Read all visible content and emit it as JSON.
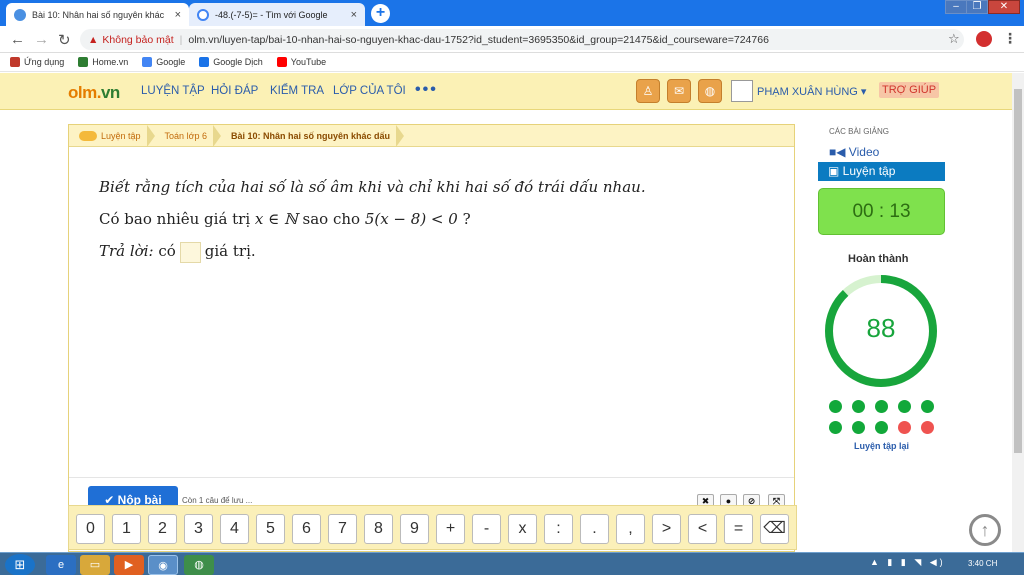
{
  "browser": {
    "tabs": [
      {
        "title": "Bài 10: Nhân hai số nguyên khác",
        "close": "×",
        "active": true
      },
      {
        "title": "-48.(-7-5)= - Tìm với Google",
        "close": "×",
        "active": false
      }
    ],
    "new_tab": "+",
    "window_buttons": {
      "minimize": "–",
      "maximize": "❐",
      "close": "✕"
    },
    "nav": {
      "back": "←",
      "forward": "→",
      "reload": "↻"
    },
    "address": {
      "warning_icon": "▲",
      "insecure_label": "Không bảo mật",
      "url": "olm.vn/luyen-tap/bai-10-nhan-hai-so-nguyen-khac-dau-1752?id_student=3695350&id_group=21475&id_courseware=724766"
    },
    "star": "☆",
    "menu": "⋮",
    "bookmarks": [
      {
        "label": "Ứng dụng",
        "color": "#c0392b"
      },
      {
        "label": "Home.vn",
        "color": "#2e7d32"
      },
      {
        "label": "Google",
        "color": "#4285f4"
      },
      {
        "label": "Google Dịch",
        "color": "#1a73e8"
      },
      {
        "label": "YouTube",
        "color": "#ff0000"
      }
    ]
  },
  "header": {
    "logo_main": "olm.",
    "logo_vn": "vn",
    "nav": [
      "LUYỆN TẬP",
      "HỎI ĐÁP",
      "KIỂM TRA",
      "LỚP CỦA TÔI"
    ],
    "nav_more": "•••",
    "user_name": "PHẠM XUÂN HÙNG ▾",
    "help": "TRỢ GIÚP"
  },
  "breadcrumb": [
    "Luyện tập",
    "Toán lớp 6",
    "Bài 10: Nhân hai số nguyên khác dấu"
  ],
  "question": {
    "line1": "Biết rằng tích của hai số là số âm khi và chỉ khi hai số đó trái dấu nhau.",
    "line2_pre": "Có bao nhiêu giá trị ",
    "line2_math": "x ∈ ℕ",
    "line2_mid": " sao cho ",
    "line2_expr": "5(x − 8) < 0",
    "line2_post": " ?",
    "answer_label": "Trả lời:",
    "answer_pre": " có",
    "answer_post": "giá trị."
  },
  "footer": {
    "submit": "✔ Nộp bài",
    "remaining": "Còn 1 câu để lưu ...",
    "tools": [
      "✖",
      "●",
      "⊘",
      "⤧"
    ]
  },
  "keypad": [
    "0",
    "1",
    "2",
    "3",
    "4",
    "5",
    "6",
    "7",
    "8",
    "9",
    "+",
    "-",
    "x",
    ":",
    ".",
    ",",
    ">",
    "<",
    "=",
    "⌫"
  ],
  "sidebar": {
    "lessons_title": "CÁC BÀI GIẢNG",
    "video": "■◀ Video",
    "practice": "▣ Luyện tập",
    "timer": "00 : 13",
    "complete_title": "Hoàn thành",
    "progress_value": "88",
    "progress_fraction": 0.88,
    "dots": [
      "green",
      "green",
      "green",
      "green",
      "green",
      "green",
      "green",
      "green",
      "red",
      "red"
    ],
    "retry": "Luyện tập lại",
    "scroll_top": "↑"
  },
  "colors": {
    "green_dot": "#12a83a",
    "red_dot": "#ef5350",
    "progress_ring": "#18a53c",
    "progress_track": "#d6f2cf"
  },
  "taskbar": {
    "start": "⊞",
    "apps": [
      "e",
      "▭",
      "▶",
      "◉",
      "◍"
    ],
    "tray": "▲ ▮ ▮ ◥ ◀)",
    "clock": "3:40 CH"
  }
}
